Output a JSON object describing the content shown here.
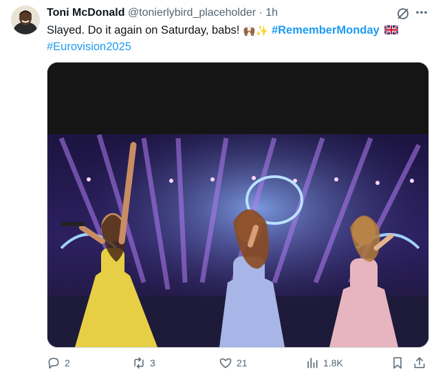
{
  "tweet": {
    "author_name": "Toni McDonald",
    "author_handle": "@tonierlybird_placeholder",
    "separator": "·",
    "time": "1h",
    "text_plain": "Slayed. Do it again on Saturday, babs!",
    "emoji_hands": "🙌🏾",
    "emoji_sparkles": "✨",
    "hashtag_1": "#RememberMonday",
    "hashtag_2": "#Eurovision2025"
  },
  "actions": {
    "replies": "2",
    "reposts": "3",
    "likes": "21",
    "views": "1.8K"
  },
  "colors": {
    "link": "#1d9bf0",
    "secondary": "#536471"
  },
  "icons": [
    "grok-icon",
    "more-icon",
    "reply-icon",
    "repost-icon",
    "like-icon",
    "views-icon",
    "bookmark-icon",
    "share-icon"
  ]
}
